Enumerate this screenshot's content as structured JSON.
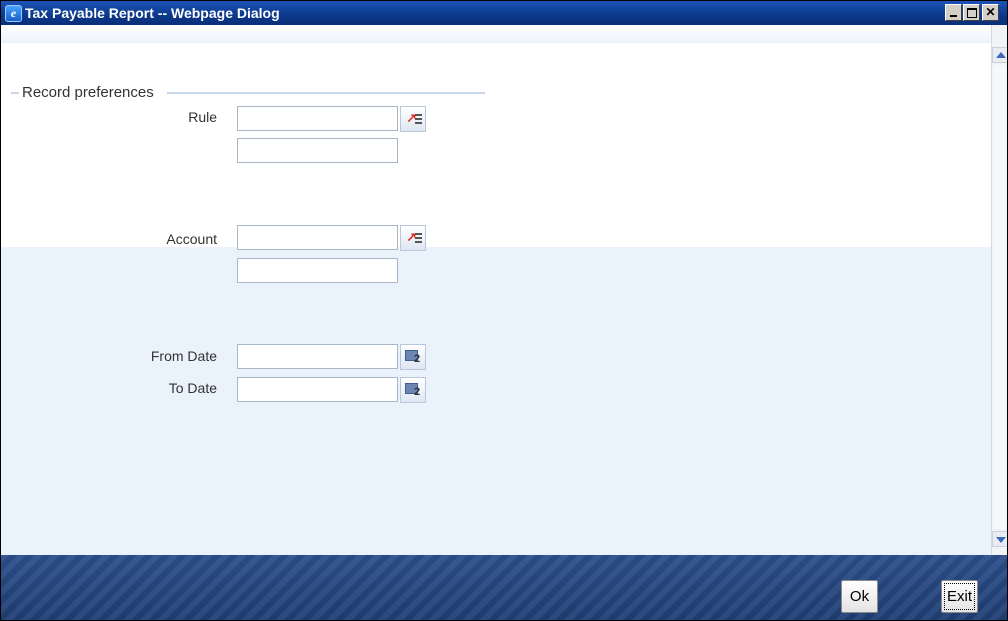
{
  "window": {
    "title": "Tax Payable Report -- Webpage Dialog",
    "app_icon": "e",
    "controls": [
      "minimize-icon",
      "maximize-icon",
      "close-icon"
    ]
  },
  "form": {
    "legend": "Record preferences",
    "rule": {
      "label": "Rule",
      "value": "",
      "description": ""
    },
    "account": {
      "label": "Account",
      "value": "",
      "description": ""
    },
    "from_date": {
      "label": "From Date",
      "value": ""
    },
    "to_date": {
      "label": "To Date",
      "value": ""
    },
    "lov_icon": "list-of-values-icon",
    "calendar_icon": "calendar-icon",
    "calendar_glyph": "2"
  },
  "footer": {
    "ok_label": "Ok",
    "exit_label": "Exit"
  },
  "colors": {
    "titlebar": "#0d3a8e",
    "footer": "#2c4f8c",
    "lower_panel": "#eaf2fb"
  }
}
